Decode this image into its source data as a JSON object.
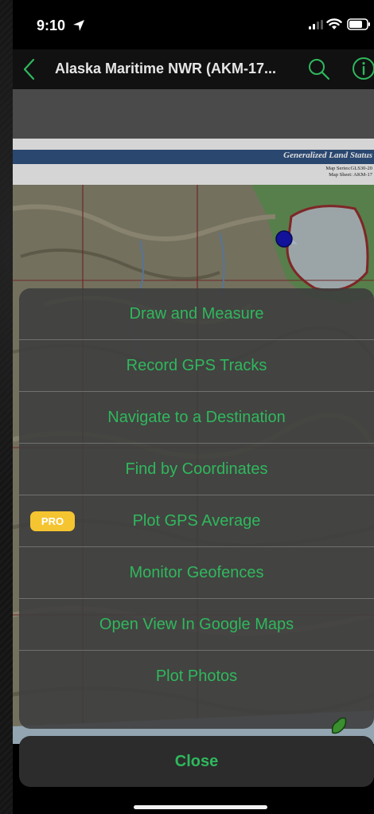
{
  "status_bar": {
    "time": "9:10"
  },
  "nav": {
    "title": "Alaska Maritime NWR (AKM-17...",
    "accent_color": "#2fb85d"
  },
  "map": {
    "header_title": "Generalized Land Status",
    "series_line1": "Map Series:GLS30-20",
    "series_line2": "Map Sheet: AKM-17"
  },
  "action_sheet": {
    "items": [
      {
        "label": "Draw and Measure"
      },
      {
        "label": "Record GPS Tracks"
      },
      {
        "label": "Navigate to a Destination"
      },
      {
        "label": "Find by Coordinates"
      },
      {
        "label": "Plot GPS Average",
        "badge": "PRO"
      },
      {
        "label": "Monitor Geofences"
      },
      {
        "label": "Open View In Google Maps"
      },
      {
        "label": "Plot Photos"
      }
    ],
    "close_label": "Close"
  }
}
